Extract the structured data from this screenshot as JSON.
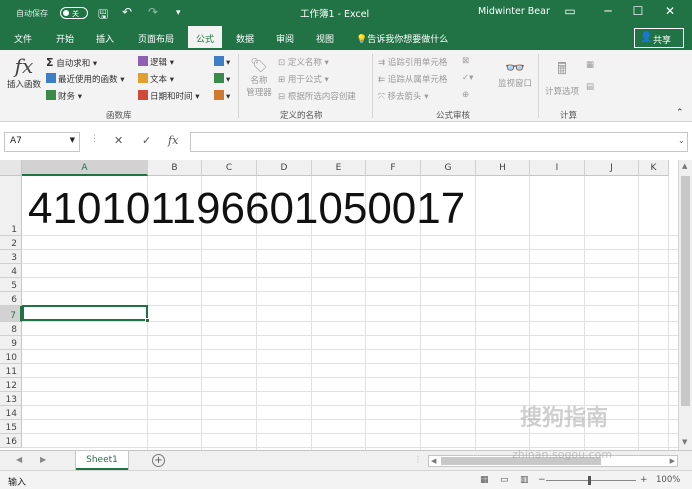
{
  "titlebar": {
    "autosave_label": "自动保存",
    "autosave_state": "关",
    "title": "工作簿1 - Excel",
    "user": "Midwinter Bear"
  },
  "tabs": [
    "文件",
    "开始",
    "插入",
    "页面布局",
    "公式",
    "数据",
    "审阅",
    "视图"
  ],
  "active_tab": "公式",
  "tellme": "告诉我你想要做什么",
  "share": "共享",
  "ribbon": {
    "insert_function": "插入函数",
    "autosum": "自动求和",
    "recent": "最近使用的函数",
    "financial": "财务",
    "logical": "逻辑",
    "text": "文本",
    "datetime": "日期和时间",
    "group_library": "函数库",
    "name_manager_1": "名称",
    "name_manager_2": "管理器",
    "define_name": "定义名称",
    "use_in_formula": "用于公式",
    "create_from_selection": "根据所选内容创建",
    "group_names": "定义的名称",
    "trace_precedents": "追踪引用单元格",
    "trace_dependents": "追踪从属单元格",
    "remove_arrows": "移去箭头",
    "watch_window": "监视窗口",
    "group_audit": "公式审核",
    "calc_options": "计算选项",
    "group_calc": "计算"
  },
  "formula_bar": {
    "name_box": "A7",
    "cancel": "✕",
    "enter": "✓",
    "fx": "fx",
    "value": ""
  },
  "columns": [
    "A",
    "B",
    "C",
    "D",
    "E",
    "F",
    "G",
    "H",
    "I",
    "J",
    "K"
  ],
  "rows": [
    "1",
    "2",
    "3",
    "4",
    "5",
    "6",
    "7",
    "8",
    "9",
    "10",
    "11",
    "12",
    "13",
    "14",
    "15",
    "16"
  ],
  "selected_cell": "A7",
  "cell_A1": "410101196601050017",
  "sheet_tab": "Sheet1",
  "status": "输入",
  "zoom": "100%",
  "watermark": "搜狗指南",
  "watermark_url": "zhinan.sogou.com"
}
